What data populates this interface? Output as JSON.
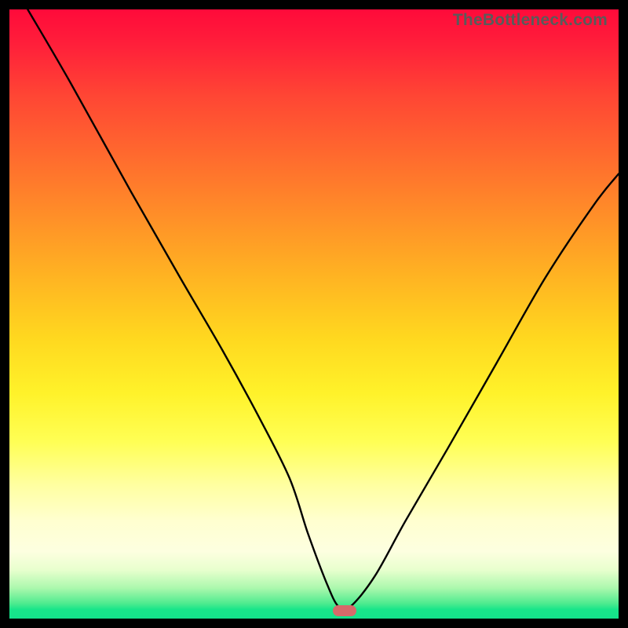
{
  "watermark": "TheBottleneck.com",
  "chart_data": {
    "type": "line",
    "title": "",
    "xlabel": "",
    "ylabel": "",
    "xlim": [
      0,
      100
    ],
    "ylim": [
      0,
      100
    ],
    "series": [
      {
        "name": "bottleneck-curve",
        "x": [
          3,
          10,
          20,
          28,
          35,
          41,
          46,
          49,
          52,
          54,
          56,
          60,
          65,
          72,
          80,
          88,
          96,
          100
        ],
        "y": [
          100,
          88,
          70,
          56,
          44,
          33,
          23,
          14,
          6,
          2,
          2,
          7,
          16,
          28,
          42,
          56,
          68,
          73
        ]
      }
    ],
    "marker": {
      "x": 55,
      "y": 1
    },
    "gradient_colors": {
      "top": "#ff0a3a",
      "mid_upper": "#ff8f28",
      "mid": "#ffd81f",
      "mid_lower": "#ffffd0",
      "bottom": "#14e28b"
    }
  }
}
